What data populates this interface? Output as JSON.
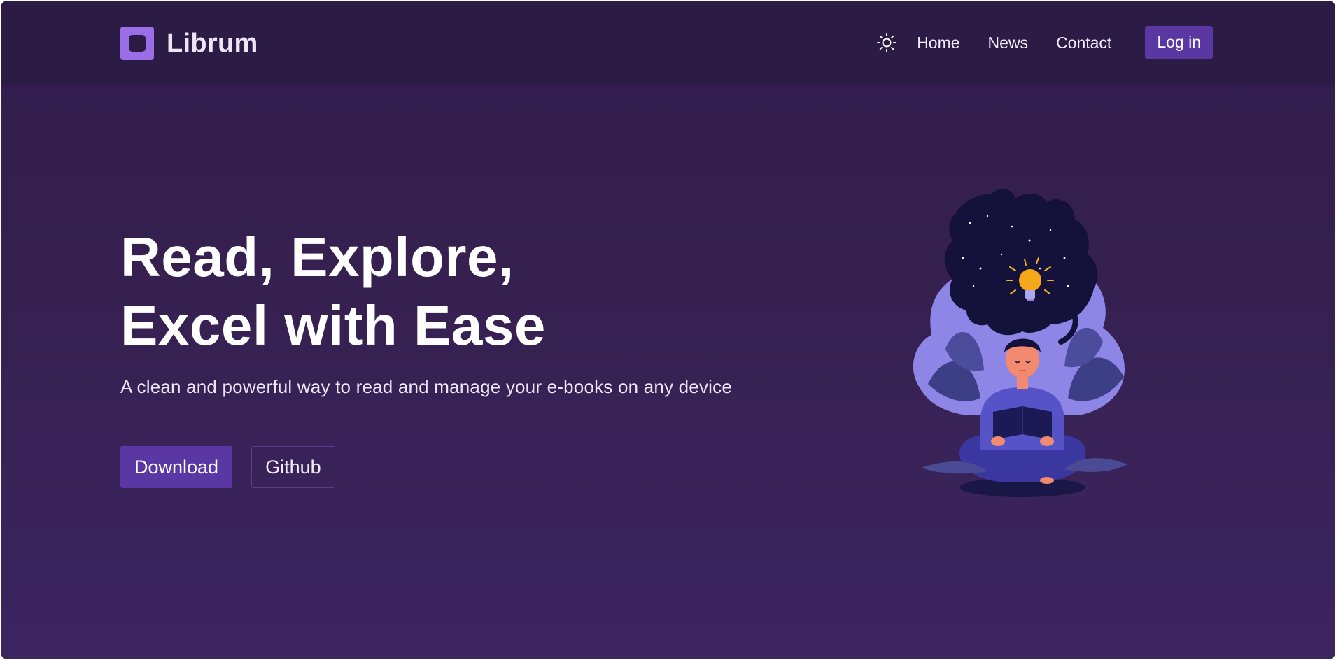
{
  "brand": {
    "name": "Librum",
    "accent_color": "#9a6ee6",
    "button_color": "#5b37a4"
  },
  "header": {
    "theme_toggle_icon": "sun-icon",
    "nav_items": [
      {
        "label": "Home"
      },
      {
        "label": "News"
      },
      {
        "label": "Contact"
      }
    ],
    "login_label": "Log in"
  },
  "hero": {
    "title_line1": "Read, Explore,",
    "title_line2": "Excel with Ease",
    "subtitle": "A clean and powerful way to read and manage your e-books on any device",
    "primary_button": "Download",
    "secondary_button": "Github",
    "illustration_icon": "reading-woman-lightbulb-illustration"
  }
}
